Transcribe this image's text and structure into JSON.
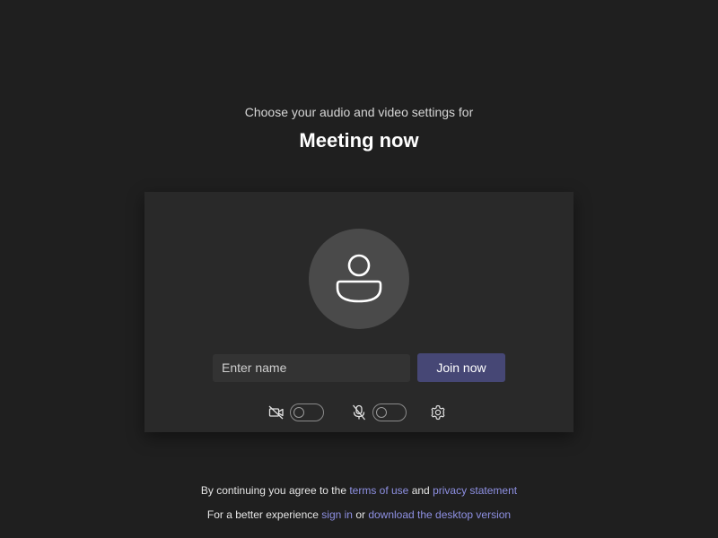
{
  "header": {
    "subtitle": "Choose your audio and video settings for",
    "title": "Meeting now"
  },
  "prejoin": {
    "avatar_icon": "person-icon",
    "name_input": {
      "value": "",
      "placeholder": "Enter name"
    },
    "join_label": "Join now",
    "camera": {
      "icon": "camera-off-icon",
      "enabled": false
    },
    "microphone": {
      "icon": "mic-off-icon",
      "enabled": false
    },
    "settings_icon": "gear-icon"
  },
  "footer": {
    "line1": {
      "prefix": "By continuing you agree to the ",
      "terms_link": "terms of use",
      "middle": " and ",
      "privacy_link": "privacy statement"
    },
    "line2": {
      "prefix": "For a better experience ",
      "signin_link": "sign in",
      "middle": " or ",
      "download_link": "download the desktop version"
    }
  },
  "colors": {
    "background": "#1f1f1f",
    "card": "#292929",
    "accent": "#464775",
    "link": "#8e90e3"
  }
}
